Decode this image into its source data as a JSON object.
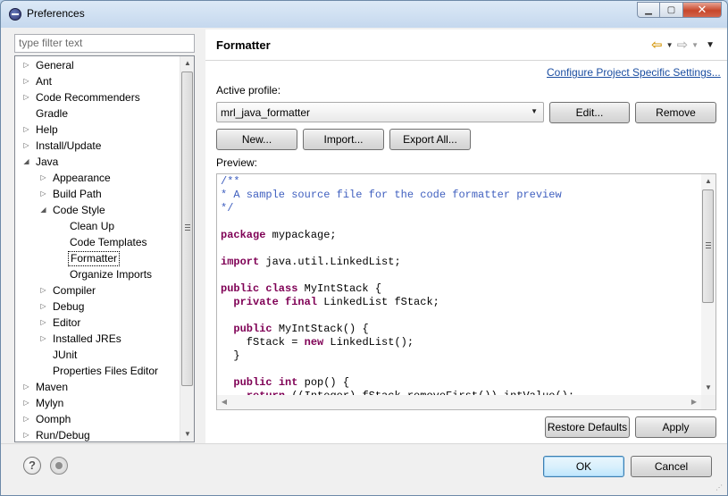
{
  "window": {
    "title": "Preferences",
    "close_glyph": "✕",
    "min_glyph": "▁",
    "max_glyph": "▢"
  },
  "left": {
    "filter_placeholder": "type filter text",
    "tree": [
      {
        "label": "General",
        "level": 0,
        "arrow": "collapsed"
      },
      {
        "label": "Ant",
        "level": 0,
        "arrow": "collapsed"
      },
      {
        "label": "Code Recommenders",
        "level": 0,
        "arrow": "collapsed"
      },
      {
        "label": "Gradle",
        "level": 0,
        "arrow": "none"
      },
      {
        "label": "Help",
        "level": 0,
        "arrow": "collapsed"
      },
      {
        "label": "Install/Update",
        "level": 0,
        "arrow": "collapsed"
      },
      {
        "label": "Java",
        "level": 0,
        "arrow": "expanded"
      },
      {
        "label": "Appearance",
        "level": 1,
        "arrow": "collapsed"
      },
      {
        "label": "Build Path",
        "level": 1,
        "arrow": "collapsed"
      },
      {
        "label": "Code Style",
        "level": 1,
        "arrow": "expanded"
      },
      {
        "label": "Clean Up",
        "level": 2,
        "arrow": "none"
      },
      {
        "label": "Code Templates",
        "level": 2,
        "arrow": "none"
      },
      {
        "label": "Formatter",
        "level": 2,
        "arrow": "none",
        "selected": true
      },
      {
        "label": "Organize Imports",
        "level": 2,
        "arrow": "none"
      },
      {
        "label": "Compiler",
        "level": 1,
        "arrow": "collapsed"
      },
      {
        "label": "Debug",
        "level": 1,
        "arrow": "collapsed"
      },
      {
        "label": "Editor",
        "level": 1,
        "arrow": "collapsed"
      },
      {
        "label": "Installed JREs",
        "level": 1,
        "arrow": "collapsed"
      },
      {
        "label": "JUnit",
        "level": 1,
        "arrow": "none"
      },
      {
        "label": "Properties Files Editor",
        "level": 1,
        "arrow": "none"
      },
      {
        "label": "Maven",
        "level": 0,
        "arrow": "collapsed"
      },
      {
        "label": "Mylyn",
        "level": 0,
        "arrow": "collapsed"
      },
      {
        "label": "Oomph",
        "level": 0,
        "arrow": "collapsed"
      },
      {
        "label": "Run/Debug",
        "level": 0,
        "arrow": "collapsed"
      }
    ]
  },
  "right": {
    "title": "Formatter",
    "configure_link": "Configure Project Specific Settings...",
    "active_profile_label": "Active profile:",
    "active_profile_value": "mrl_java_formatter",
    "edit_button": "Edit...",
    "remove_button": "Remove",
    "new_button": "New...",
    "import_button": "Import...",
    "export_button": "Export All...",
    "preview_label": "Preview:",
    "preview_lines": [
      [
        {
          "t": "/**",
          "c": "com"
        }
      ],
      [
        {
          "t": "* A sample source file for the code formatter preview",
          "c": "com"
        }
      ],
      [
        {
          "t": "*/",
          "c": "com"
        }
      ],
      [],
      [
        {
          "t": "package",
          "c": "kw"
        },
        {
          "t": " mypackage;",
          "c": "pl"
        }
      ],
      [],
      [
        {
          "t": "import",
          "c": "kw"
        },
        {
          "t": " java.util.LinkedList;",
          "c": "pl"
        }
      ],
      [],
      [
        {
          "t": "public class",
          "c": "kw"
        },
        {
          "t": " MyIntStack {",
          "c": "pl"
        }
      ],
      [
        {
          "t": "  ",
          "c": "pl"
        },
        {
          "t": "private final",
          "c": "kw"
        },
        {
          "t": " LinkedList fStack;",
          "c": "pl"
        }
      ],
      [],
      [
        {
          "t": "  ",
          "c": "pl"
        },
        {
          "t": "public",
          "c": "kw"
        },
        {
          "t": " MyIntStack() {",
          "c": "pl"
        }
      ],
      [
        {
          "t": "    fStack = ",
          "c": "pl"
        },
        {
          "t": "new",
          "c": "kw"
        },
        {
          "t": " LinkedList();",
          "c": "pl"
        }
      ],
      [
        {
          "t": "  }",
          "c": "pl"
        }
      ],
      [],
      [
        {
          "t": "  ",
          "c": "pl"
        },
        {
          "t": "public int",
          "c": "kw"
        },
        {
          "t": " pop() {",
          "c": "pl"
        }
      ],
      [
        {
          "t": "    ",
          "c": "pl"
        },
        {
          "t": "return",
          "c": "kw"
        },
        {
          "t": " ((Integer) fStack.removeFirst()).intValue();",
          "c": "pl"
        }
      ]
    ],
    "restore_defaults_button": "Restore Defaults",
    "apply_button": "Apply"
  },
  "footer": {
    "ok_button": "OK",
    "cancel_button": "Cancel",
    "help_glyph": "?"
  },
  "icons": {
    "nav_back": "⇦",
    "nav_forward": "⇨",
    "dropdown": "▼",
    "collapsed": "▷",
    "expanded": "◢"
  },
  "colors": {
    "link": "#1b4ea1",
    "keyword": "#7f0055",
    "comment": "#3f5fbf",
    "nav_back": "#d69a12"
  }
}
